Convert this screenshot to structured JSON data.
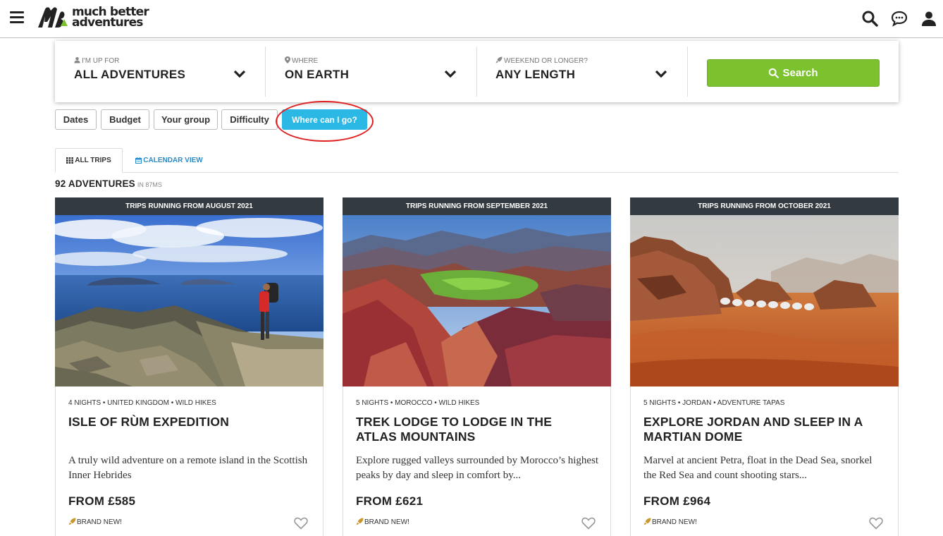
{
  "header": {
    "brand_line1": "much better",
    "brand_line2": "adventures",
    "menu_icon": "hamburger-menu-icon",
    "icons": [
      "search-icon",
      "chat-icon",
      "user-icon"
    ]
  },
  "search": {
    "fields": [
      {
        "label": "I'M UP FOR",
        "value": "ALL ADVENTURES",
        "icon": "user-icon"
      },
      {
        "label": "WHERE",
        "value": "ON EARTH",
        "icon": "map-pin-icon"
      },
      {
        "label": "WEEKEND OR LONGER?",
        "value": "ANY LENGTH",
        "icon": "rocket-icon"
      }
    ],
    "button_label": "Search"
  },
  "filters": [
    {
      "label": "Dates",
      "active": false
    },
    {
      "label": "Budget",
      "active": false
    },
    {
      "label": "Your group",
      "active": false
    },
    {
      "label": "Difficulty",
      "active": false
    },
    {
      "label": "Where can I go?",
      "active": true
    }
  ],
  "tabs": [
    {
      "label": "ALL TRIPS",
      "icon": "grid-icon",
      "active": true
    },
    {
      "label": "CALENDAR VIEW",
      "icon": "calendar-icon",
      "active": false
    }
  ],
  "results": {
    "count": "92 ADVENTURES",
    "timing": "IN 87MS"
  },
  "cards": [
    {
      "banner": "TRIPS RUNNING FROM AUGUST 2021",
      "meta": "4 NIGHTS • UNITED KINGDOM • WILD HIKES",
      "title": "ISLE OF RÙM EXPEDITION",
      "description": "A truly wild adventure on a remote island in the Scottish Inner Hebrides",
      "price": "FROM £585",
      "badge": "BRAND NEW!"
    },
    {
      "banner": "TRIPS RUNNING FROM SEPTEMBER 2021",
      "meta": "5 NIGHTS • MOROCCO • WILD HIKES",
      "title": "TREK LODGE TO LODGE IN THE ATLAS MOUNTAINS",
      "description": "Explore rugged valleys surrounded by Morocco’s highest peaks by day and sleep in comfort by...",
      "price": "FROM £621",
      "badge": "BRAND NEW!"
    },
    {
      "banner": "TRIPS RUNNING FROM OCTOBER 2021",
      "meta": "5 NIGHTS • JORDAN • ADVENTURE TAPAS",
      "title": "EXPLORE JORDAN AND SLEEP IN A MARTIAN DOME",
      "description": "Marvel at ancient Petra, float in the Dead Sea, snorkel the Red Sea and count shooting stars...",
      "price": "FROM £964",
      "badge": "BRAND NEW!"
    }
  ],
  "colors": {
    "accent_green": "#7bc22e",
    "active_filter": "#2bb8e5",
    "link_blue": "#2a8bc9",
    "banner_dark": "#333a40",
    "annotation_red": "#e02020"
  }
}
